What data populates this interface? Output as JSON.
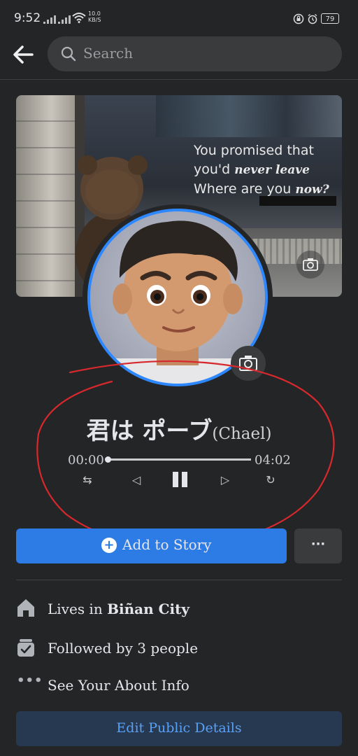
{
  "status_bar": {
    "time": "9:52",
    "net_speed_value": "10.0",
    "net_speed_unit": "KB/S",
    "battery": "79"
  },
  "top_bar": {
    "search_placeholder": "Search"
  },
  "cover": {
    "line1": "You promised that",
    "line2_prefix": "you'd ",
    "line2_emph": "never leave",
    "line3_prefix": "Where are you ",
    "line3_emph": "now?"
  },
  "music": {
    "title_jp": "君は ポーブ",
    "title_en": "(Chael)",
    "time_current": "00:00",
    "time_total": "04:02",
    "progress": 0.0
  },
  "actions": {
    "add_story": "Add to Story",
    "more": "···"
  },
  "info": {
    "lives_prefix": "Lives in ",
    "lives_city": "Biñan City",
    "followed": "Followed by 3 people",
    "about": "See Your About Info"
  },
  "edit_button": "Edit Public Details",
  "colors": {
    "background": "#242526",
    "accent_blue": "#2d7be5",
    "avatar_ring": "#2d88ff",
    "annotation_red": "#d7282d",
    "edit_button_bg": "#263951",
    "edit_button_text": "#5aa0f5"
  }
}
